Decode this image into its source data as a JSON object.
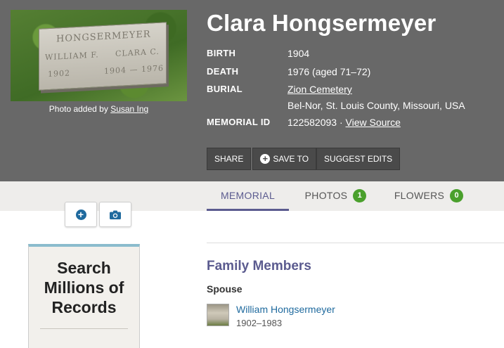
{
  "memorial": {
    "name": "Clara Hongsermeyer",
    "photo_caption_prefix": "Photo added by",
    "photo_added_by": "Susan Ing",
    "headstone": {
      "surname": "HONGSERMEYER",
      "left_name": "WILLIAM F.",
      "right_name": "CLARA C.",
      "left_year": "1902",
      "right_years": "1904 — 1976"
    },
    "facts": {
      "birth_label": "BIRTH",
      "birth_value": "1904",
      "death_label": "DEATH",
      "death_value": "1976 (aged 71–72)",
      "burial_label": "BURIAL",
      "burial_cemetery": "Zion Cemetery",
      "burial_location": "Bel-Nor, St. Louis County, Missouri, USA",
      "memorial_id_label": "MEMORIAL ID",
      "memorial_id_value": "122582093 ·",
      "view_source": "View Source"
    }
  },
  "actions": {
    "share": "SHARE",
    "save_to": "SAVE TO",
    "suggest_edits": "SUGGEST EDITS"
  },
  "tabs": [
    {
      "label": "MEMORIAL",
      "active": true
    },
    {
      "label": "PHOTOS",
      "count": "1"
    },
    {
      "label": "FLOWERS",
      "count": "0"
    }
  ],
  "side_buttons": {
    "add_icon": "plus-circle-icon",
    "photo_icon": "camera-icon"
  },
  "ad": {
    "line1": "Search",
    "line2": "Millions of",
    "line3": "Records"
  },
  "family": {
    "title": "Family Members",
    "relation": "Spouse",
    "members": [
      {
        "name": "William Hongsermeyer",
        "dates": "1902–1983"
      }
    ]
  },
  "colors": {
    "hero_bg": "#686868",
    "accent": "#5b5b8f",
    "link": "#1f6a9e",
    "badge": "#4aa02c"
  }
}
